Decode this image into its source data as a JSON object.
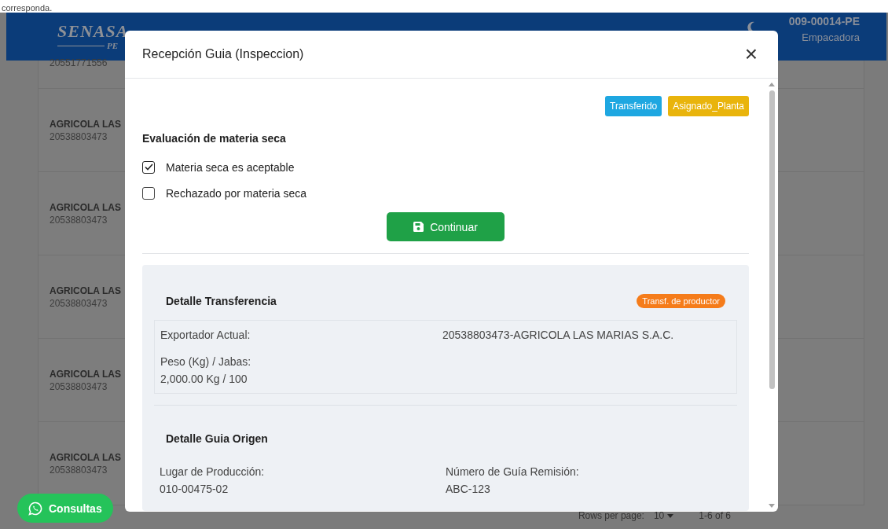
{
  "top_text": "corresponda.",
  "header": {
    "logo": "SENASA",
    "logo_sub": "PE",
    "user_code": "009-00014-PE",
    "user_role": "Empacadora"
  },
  "list_rows": [
    {
      "name": "",
      "id": "20551771556"
    },
    {
      "name": "AGRICOLA LAS",
      "id": "20538803473"
    },
    {
      "name": "AGRICOLA LAS",
      "id": "20538803473"
    },
    {
      "name": "AGRICOLA LAS",
      "id": "20538803473"
    },
    {
      "name": "AGRICOLA LAS",
      "id": "20538803473"
    },
    {
      "name": "AGRICOLA LAS",
      "id": "20538803473"
    }
  ],
  "pagination": {
    "rows_label": "Rows per page:",
    "rows_value": "10",
    "range": "1-6 of 6"
  },
  "chat_button": {
    "label": "Consultas"
  },
  "modal": {
    "title": "Recepción Guia (Inspeccion)",
    "close": "×",
    "status_badges": [
      {
        "label": "Transferido",
        "color": "#1ea7e1"
      },
      {
        "label": "Asignado_Planta",
        "color": "#e9b40c"
      }
    ],
    "evaluation_title": "Evaluación de materia seca",
    "options": [
      {
        "label": "Materia seca es aceptable",
        "checked": true
      },
      {
        "label": "Rechazado por materia seca",
        "checked": false
      }
    ],
    "continue_button": "Continuar",
    "sections": [
      {
        "title": "Detalle Transferencia",
        "badge": "Transf. de productor",
        "boxed": true,
        "fields": [
          {
            "kind": "pair",
            "label": "Exportador Actual:",
            "value": "20538803473-AGRICOLA LAS MARIAS S.A.C."
          },
          {
            "kind": "stacked",
            "label": "Peso (Kg) / Jabas:",
            "value": "2,000.00 Kg / 100"
          }
        ]
      },
      {
        "title": "Detalle Guia Origen",
        "boxed": false,
        "fields": [
          {
            "kind": "stacked",
            "label": "Lugar de Producción:",
            "value": "010-00475-02"
          },
          {
            "kind": "stacked",
            "label": "Número de Guía Remisión:",
            "value": "ABC-123"
          }
        ]
      }
    ]
  }
}
